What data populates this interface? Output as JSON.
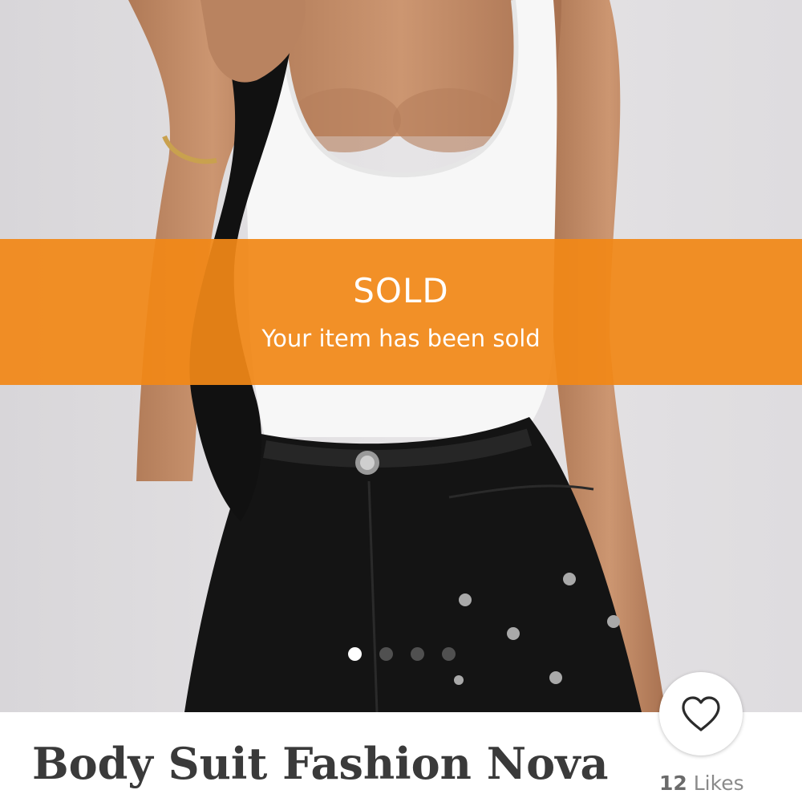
{
  "banner": {
    "title": "SOLD",
    "subtitle": "Your item has been sold",
    "color": "#F1881A"
  },
  "carousel": {
    "total": 4,
    "active_index": 0
  },
  "like": {
    "icon": "heart-outline-icon",
    "count": "12",
    "label": "Likes"
  },
  "listing": {
    "title": "Body Suit Fashion Nova"
  }
}
